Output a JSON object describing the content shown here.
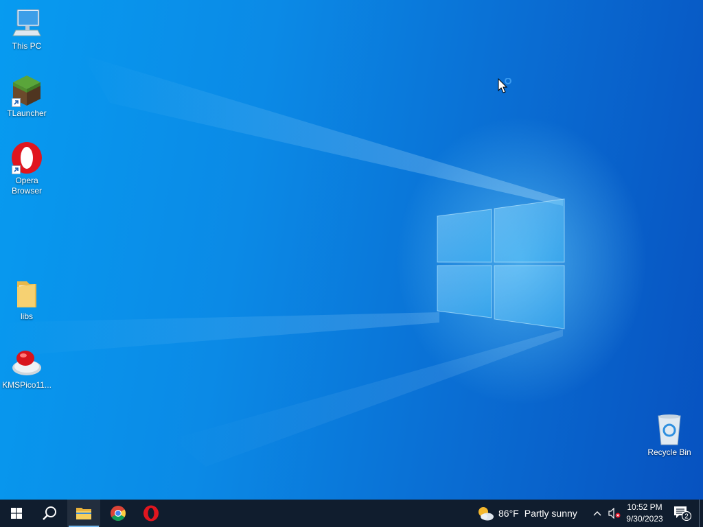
{
  "desktop": {
    "icons": [
      {
        "label": "This PC",
        "icon": "computer-icon",
        "shortcut": false
      },
      {
        "label": "TLauncher",
        "icon": "grass-block-icon",
        "shortcut": true
      },
      {
        "label": "Opera Browser",
        "icon": "opera-icon",
        "shortcut": true
      },
      {
        "label": "libs",
        "icon": "folder-icon",
        "shortcut": false
      },
      {
        "label": "KMSPico11...",
        "icon": "red-button-icon",
        "shortcut": false
      },
      {
        "label": "Recycle Bin",
        "icon": "recycle-bin-icon",
        "shortcut": false
      }
    ]
  },
  "taskbar": {
    "pinned": [
      {
        "name": "start",
        "icon": "windows-logo-icon"
      },
      {
        "name": "search",
        "icon": "search-icon"
      },
      {
        "name": "file-explorer",
        "icon": "folder-icon",
        "active": true
      },
      {
        "name": "chrome",
        "icon": "chrome-icon"
      },
      {
        "name": "opera",
        "icon": "opera-icon"
      }
    ],
    "weather": {
      "temperature": "86°F",
      "condition": "Partly sunny",
      "icon": "partly-sunny-icon"
    },
    "tray": {
      "chevron_icon": "chevron-up-icon",
      "volume_icon": "volume-muted-icon"
    },
    "clock": {
      "time": "10:52 PM",
      "date": "9/30/2023"
    },
    "notifications": {
      "count": "2",
      "icon": "action-center-icon"
    }
  },
  "colors": {
    "taskbar_bg": "#101d2e",
    "desktop_blue": "#0a6fd4",
    "accent": "#76b9ed"
  }
}
